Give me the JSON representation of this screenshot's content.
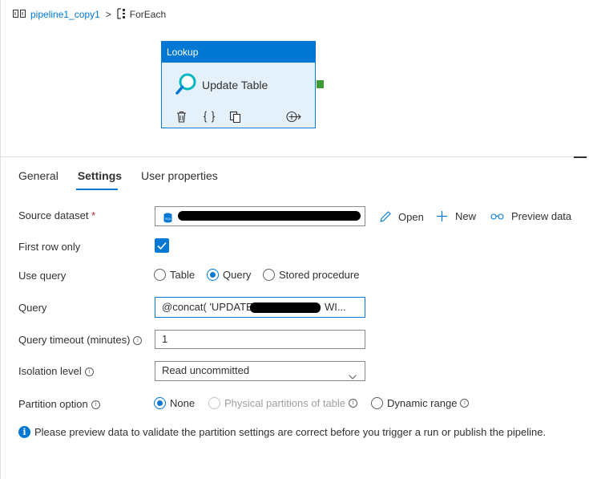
{
  "breadcrumb": {
    "pipeline": "pipeline1_copy1",
    "separator": ">",
    "current": "ForEach"
  },
  "activity": {
    "type": "Lookup",
    "name": "Update Table",
    "tools": [
      "delete-icon",
      "code-icon",
      "copy-icon",
      "add-output-icon"
    ]
  },
  "tabs": [
    {
      "label": "General",
      "active": false
    },
    {
      "label": "Settings",
      "active": true
    },
    {
      "label": "User properties",
      "active": false
    }
  ],
  "form": {
    "source_dataset": {
      "label": "Source dataset",
      "required_mark": "*"
    },
    "actions": {
      "open": "Open",
      "new": "New",
      "preview": "Preview data"
    },
    "first_row_only": {
      "label": "First row only",
      "checked": true
    },
    "use_query": {
      "label": "Use query",
      "options": [
        "Table",
        "Query",
        "Stored procedure"
      ],
      "selected": "Query"
    },
    "query": {
      "label": "Query",
      "value_prefix": "@concat( 'UPDATE",
      "value_suffix": "WI..."
    },
    "query_timeout": {
      "label": "Query timeout (minutes)",
      "value": "1"
    },
    "isolation_level": {
      "label": "Isolation level",
      "value": "Read uncommitted"
    },
    "partition_option": {
      "label": "Partition option",
      "options": [
        "None",
        "Physical partitions of table",
        "Dynamic range"
      ],
      "selected": "None"
    }
  },
  "info_note": "Please preview data to validate the partition settings are correct before you trigger a run or publish the pipeline.",
  "colors": {
    "accent": "#0078d4",
    "success_port": "#3f9b36",
    "required": "#a4262c"
  }
}
